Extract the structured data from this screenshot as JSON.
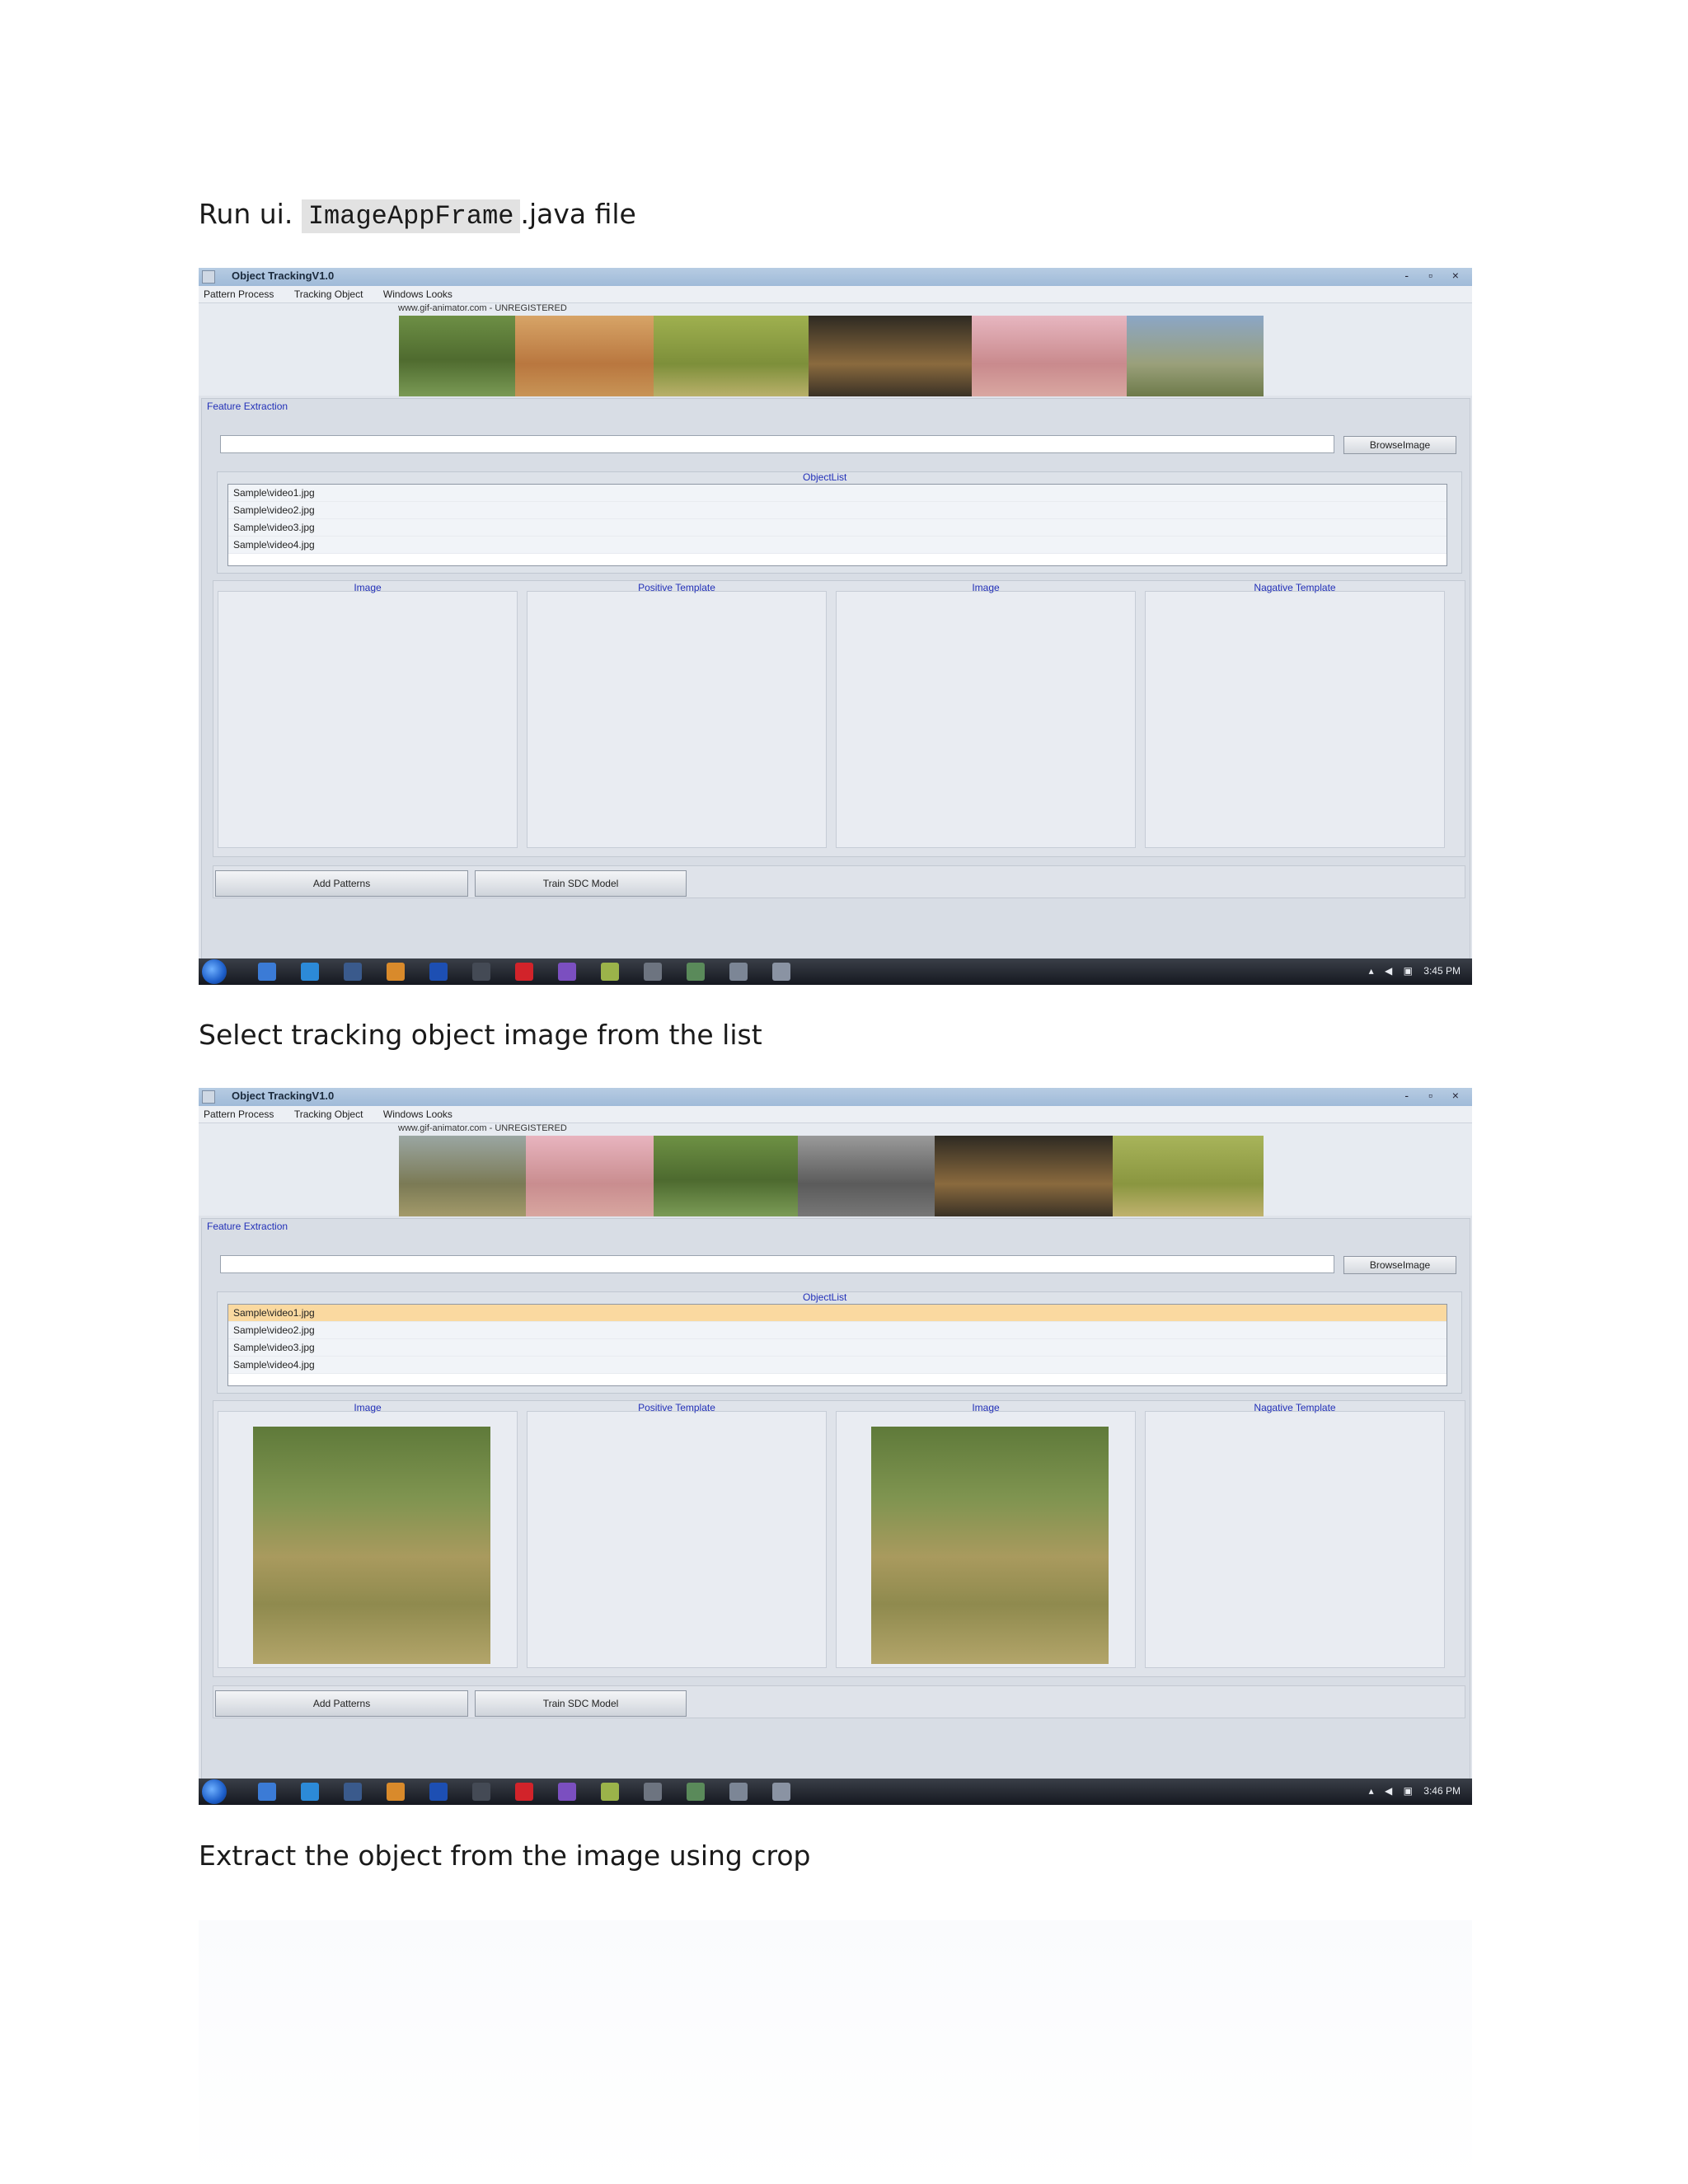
{
  "document": {
    "step1_prefix": "Run ui.",
    "step1_code": "ImageAppFrame",
    "step1_suffix": ".java file",
    "step2": "Select tracking object image from the list",
    "step3": "Extract the object from the image using crop"
  },
  "app": {
    "title": "Object TrackingV1.0",
    "window_controls": "- ▫ ×",
    "menu": [
      "Pattern Process",
      "Tracking Object",
      "Windows Looks"
    ],
    "banner_credit": "www.gif-animator.com - UNREGISTERED",
    "feature_extraction_label": "Feature Extraction",
    "browse_button": "BrowseImage",
    "object_list_label": "ObjectList",
    "objects": [
      "Sample\\video1.jpg",
      "Sample\\video2.jpg",
      "Sample\\video3.jpg",
      "Sample\\video4.jpg"
    ],
    "viewer_labels": [
      "Image",
      "Positive Template",
      "Image",
      "Nagative Template"
    ],
    "add_patterns_button": "Add Patterns",
    "train_button": "Train SDC Model"
  },
  "screenshot1": {
    "clock": "3:45 PM",
    "selected_index": -1
  },
  "screenshot2": {
    "clock": "3:46 PM",
    "selected_index": 0
  },
  "colors": {
    "label_blue": "#2230b8",
    "selection": "#fad9a0",
    "taskbar": "#151820"
  }
}
